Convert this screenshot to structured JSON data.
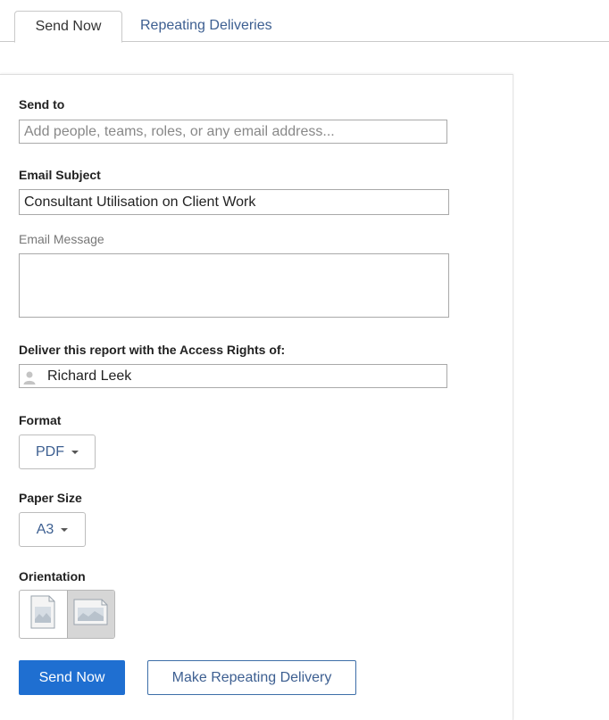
{
  "tabs": [
    {
      "label": "Send Now",
      "active": true
    },
    {
      "label": "Repeating Deliveries",
      "active": false
    }
  ],
  "form": {
    "send_to": {
      "label": "Send to",
      "placeholder": "Add people, teams, roles, or any email address...",
      "value": ""
    },
    "subject": {
      "label": "Email Subject",
      "value": "Consultant Utilisation on Client Work"
    },
    "message": {
      "label": "Email Message",
      "value": ""
    },
    "access_rights": {
      "label": "Deliver this report with the Access Rights of:",
      "value": "Richard Leek",
      "icon": "user-icon"
    },
    "format": {
      "label": "Format",
      "selected": "PDF"
    },
    "paper_size": {
      "label": "Paper Size",
      "selected": "A3"
    },
    "orientation": {
      "label": "Orientation",
      "options": [
        "portrait",
        "landscape"
      ],
      "selected": "landscape"
    }
  },
  "actions": {
    "send_now": "Send Now",
    "make_repeating": "Make Repeating Delivery"
  },
  "colors": {
    "primary": "#1f6fd1",
    "link": "#3d5f91"
  }
}
